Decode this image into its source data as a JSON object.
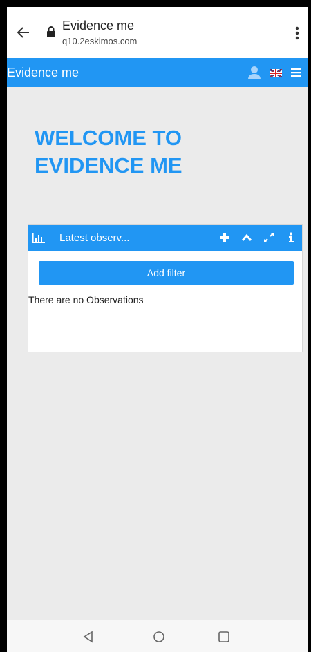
{
  "browser": {
    "page_title": "Evidence me",
    "url": "q10.2eskimos.com"
  },
  "header": {
    "app_title": "Evidence me"
  },
  "welcome": {
    "line1": "WELCOME TO",
    "line2": "EVIDENCE ME"
  },
  "widget": {
    "title": "Latest observ...",
    "add_filter_label": "Add filter",
    "empty_message": "There are no Observations",
    "icons": [
      "chart-icon",
      "plus-icon",
      "chevron-up-icon",
      "expand-icon",
      "info-icon"
    ]
  },
  "colors": {
    "accent": "#2196f3",
    "background": "#ebebeb"
  }
}
